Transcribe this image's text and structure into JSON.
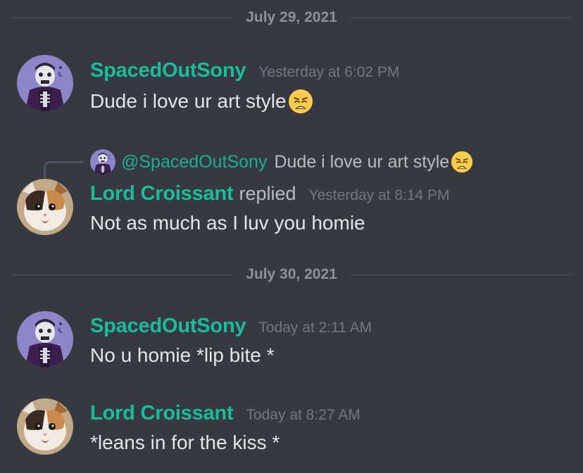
{
  "dividers": [
    "July 29, 2021",
    "July 30, 2021"
  ],
  "messages": [
    {
      "username": "SpacedOutSony",
      "timestamp": "Yesterday at 6:02 PM",
      "text": "Dude i love ur art style",
      "emoji": "weary-face-emoji"
    },
    {
      "username": "Lord Croissant",
      "replied_label": "replied",
      "timestamp": "Yesterday at 8:14 PM",
      "text": "Not as much as I luv you homie",
      "reply_to": {
        "mention": "@SpacedOutSony",
        "text": "Dude i love ur art style",
        "emoji": "weary-face-emoji"
      }
    },
    {
      "username": "SpacedOutSony",
      "timestamp": "Today at 2:11 AM",
      "text": "No u homie *lip bite *"
    },
    {
      "username": "Lord Croissant",
      "timestamp": "Today at 8:27 AM",
      "text": "*leans in for the kiss *"
    }
  ],
  "colors": {
    "background": "#36393f",
    "username": "#1abc9c",
    "timestamp": "#72767d",
    "text": "#e4e5e7",
    "divider": "#4f545c"
  }
}
